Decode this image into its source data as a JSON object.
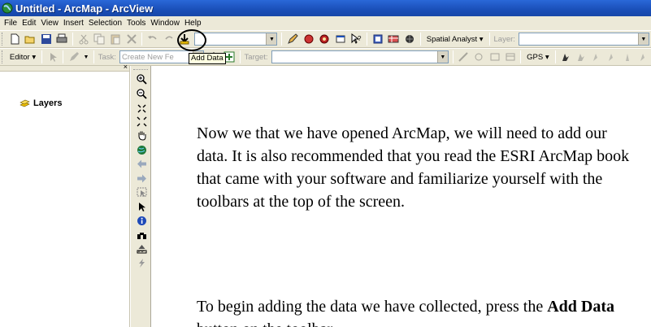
{
  "window": {
    "title": "Untitled - ArcMap - ArcView"
  },
  "menu": [
    "File",
    "Edit",
    "View",
    "Insert",
    "Selection",
    "Tools",
    "Window",
    "Help"
  ],
  "toolbar1": {
    "scale_combo_value": "",
    "spatial_analyst_label": "Spatial Analyst ▾",
    "layer_label": "Layer:",
    "layer_value": ""
  },
  "toolbar2": {
    "editor_label": "Editor ▾",
    "task_label": "Task:",
    "task_value": "Create New Fe",
    "target_label": "Target:",
    "target_value": "",
    "gps_label": "GPS ▾"
  },
  "tooltip": {
    "text": "Add Data"
  },
  "toc": {
    "root_label": "Layers",
    "close_glyph": "×"
  },
  "document": {
    "paragraph1": "Now we that we have opened ArcMap, we will need to add our data.  It is also recommended that you read the ESRI ArcMap book that came with your software and familiarize yourself with the toolbars at the top of the screen.",
    "paragraph2_prefix": "To begin adding the data we have collected, press the ",
    "paragraph2_bold": "Add Data",
    "paragraph2_suffix": " button on the toolbar."
  },
  "icons": {
    "app": "globe-icon",
    "add_data": "add-data-icon",
    "layers": "layers-icon"
  },
  "colors": {
    "titlebar": "#1a4fb8",
    "chrome": "#ece9d8",
    "tooltip": "#ffffe1"
  }
}
